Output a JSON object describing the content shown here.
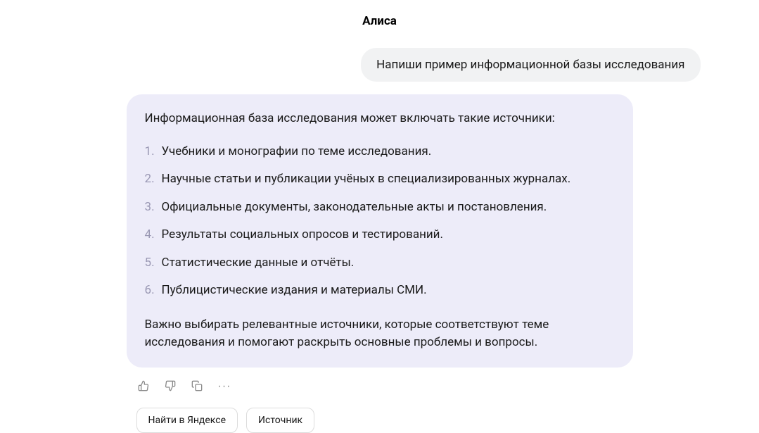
{
  "header": {
    "title": "Алиса"
  },
  "user_message": "Напиши пример информационной базы исследования",
  "assistant_message": {
    "intro": "Информационная база исследования может включать такие источники:",
    "items": [
      "Учебники и монографии по теме исследования.",
      "Научные статьи и публикации учёных в специализированных журналах.",
      "Официальные документы, законодательные акты и постановления.",
      "Результаты социальных опросов и тестирований.",
      "Статистические данные и отчёты.",
      "Публицистические издания и материалы СМИ."
    ],
    "outro": "Важно выбирать релевантные источники, которые соответствуют теме исследования и помогают раскрыть основные проблемы и вопросы."
  },
  "actions": {
    "yandex_search_label": "Найти в Яндексе",
    "source_label": "Источник"
  }
}
